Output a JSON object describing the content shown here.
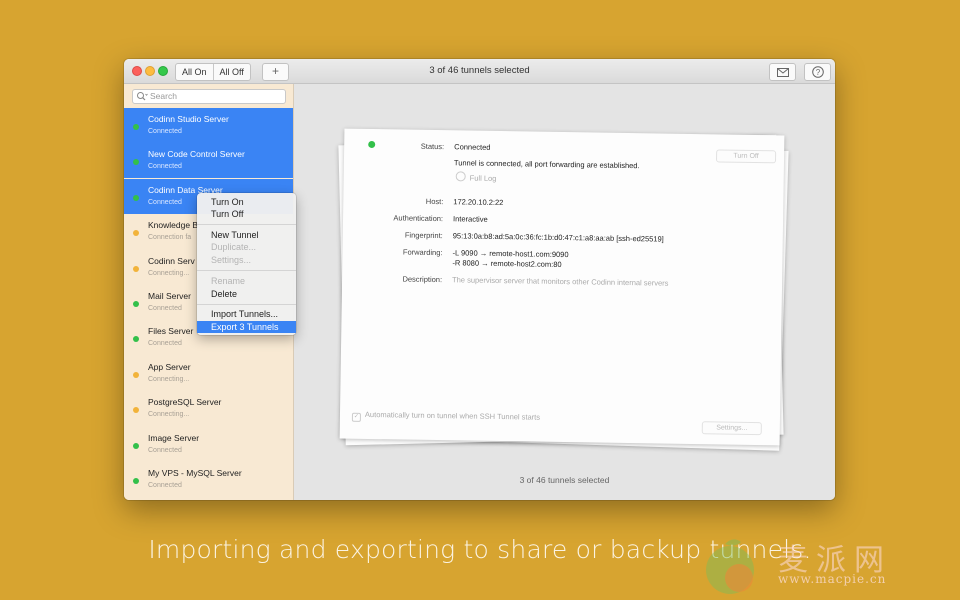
{
  "toolbar": {
    "all_on": "All On",
    "all_off": "All Off",
    "add": "+",
    "title": "3 of 46 tunnels selected"
  },
  "sidebar": {
    "search_placeholder": "Search",
    "items": [
      {
        "name": "Codinn Studio Server",
        "status": "Connected",
        "state": "connected",
        "selected": true
      },
      {
        "name": "New Code Control Server",
        "status": "Connected",
        "state": "connected",
        "selected": true
      },
      {
        "name": "Codinn Data Server",
        "status": "Connected",
        "state": "connected",
        "selected": true
      },
      {
        "name": "Knowledge B",
        "status": "Connection fa",
        "state": "connecting",
        "selected": false
      },
      {
        "name": "Codinn Serv",
        "status": "Connecting...",
        "state": "connecting",
        "selected": false
      },
      {
        "name": "Mail Server",
        "status": "Connected",
        "state": "connected",
        "selected": false
      },
      {
        "name": "Files Server",
        "status": "Connected",
        "state": "connected",
        "selected": false
      },
      {
        "name": "App Server",
        "status": "Connecting...",
        "state": "connecting",
        "selected": false
      },
      {
        "name": "PostgreSQL Server",
        "status": "Connecting...",
        "state": "connecting",
        "selected": false
      },
      {
        "name": "Image Server",
        "status": "Connected",
        "state": "connected",
        "selected": false
      },
      {
        "name": "My VPS - MySQL Server",
        "status": "Connected",
        "state": "connected",
        "selected": false
      }
    ]
  },
  "context_menu": {
    "turn_on": "Turn On",
    "turn_off": "Turn Off",
    "new_tunnel": "New Tunnel",
    "duplicate": "Duplicate...",
    "settings": "Settings...",
    "rename": "Rename",
    "delete": "Delete",
    "import": "Import Tunnels...",
    "export": "Export 3 Tunnels"
  },
  "detail": {
    "status_label": "Status:",
    "status_value": "Connected",
    "status_message": "Tunnel is connected, all port forwarding are established.",
    "full_log": "Full Log",
    "turn_off_button": "Turn Off",
    "host_label": "Host:",
    "host_value": "172.20.10.2:22",
    "auth_label": "Authentication:",
    "auth_value": "Interactive",
    "fingerprint_label": "Fingerprint:",
    "fingerprint_value": "95:13:0a:b8:ad:5a:0c:36:fc:1b:d0:47:c1:a8:aa:ab [ssh-ed25519]",
    "forwarding_label": "Forwarding:",
    "forwarding_1": "-L    9090 → remote-host1.com:9090",
    "forwarding_2": "-R    8080 → remote-host2.com:80",
    "description_label": "Description:",
    "description_value": "The supervisor server that monitors other Codinn internal servers",
    "auto_turn_on": "Automatically turn on tunnel when SSH Tunnel starts",
    "settings_button": "Settings..."
  },
  "footer": "3 of 46 tunnels selected",
  "caption": "Importing and exporting to share or backup tunnels.",
  "watermark": {
    "cn": "麦派网",
    "url": "www.macpie.cn"
  },
  "colors": {
    "background": "#d7a430",
    "selection": "#3a84f4",
    "connected": "#33c04a",
    "connecting": "#f2b33a"
  }
}
